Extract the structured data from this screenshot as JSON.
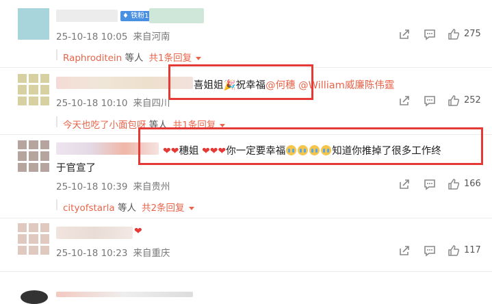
{
  "comments": [
    {
      "badge": "铁粉1",
      "date": "25-10-18 10:05",
      "location": "来自河南",
      "likes": "275",
      "replies": {
        "nick": "Raphroditein",
        "mid": "等人",
        "count": "共1条回复"
      }
    },
    {
      "text_pre": "喜姐姐",
      "text_mid": "祝幸福",
      "mentions": [
        "@何穗",
        "@William威廉陈伟霆"
      ],
      "date": "25-10-18 10:10",
      "location": "来自四川",
      "likes": "252",
      "replies": {
        "nick": "今天也吃了小面包呀",
        "mid": "等人",
        "count": "共1条回复"
      }
    },
    {
      "text_a": "穗姐",
      "text_b": "你一定要幸福",
      "text_c": "知道你推掉了很多工作终",
      "text_line2": "于官宣了",
      "date": "25-10-18 10:39",
      "location": "来自贵州",
      "likes": "166",
      "replies": {
        "nick": "cityofstarla",
        "mid": "等人",
        "count": "共2条回复"
      }
    },
    {
      "date": "25-10-18 10:23",
      "location": "来自重庆",
      "likes": "117"
    }
  ],
  "colors": {
    "accent": "#e8644a",
    "highlight_box": "#e53935"
  },
  "icons": [
    "share-icon",
    "comment-icon",
    "like-icon"
  ]
}
